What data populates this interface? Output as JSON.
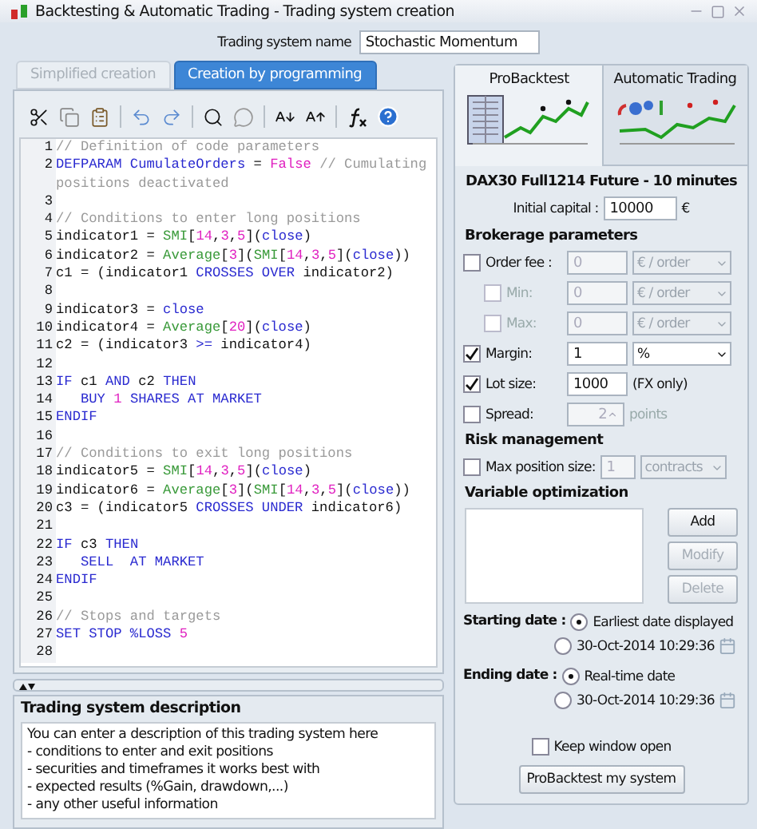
{
  "window": {
    "title": "Backtesting & Automatic Trading - Trading system creation"
  },
  "name_field": {
    "label": "Trading system name",
    "value": "Stochastic Momentum"
  },
  "editor_tabs": [
    {
      "label": "Simplified creation",
      "selected": false
    },
    {
      "label": "Creation by programming",
      "selected": true
    }
  ],
  "code_lines": [
    {
      "number": "1",
      "tokens": [
        {
          "kind": "comment",
          "text": "// Definition of code parameters"
        }
      ]
    },
    {
      "number": "2",
      "tokens": [
        {
          "kind": "keyword",
          "text": "DEFPARAM CumulateOrders"
        },
        {
          "kind": "plain",
          "text": " = "
        },
        {
          "kind": "number",
          "text": "False"
        },
        {
          "kind": "comment",
          "text": " // Cumulating"
        }
      ]
    },
    {
      "tokens": [
        {
          "kind": "comment",
          "text": "positions deactivated"
        }
      ]
    },
    {
      "number": "3"
    },
    {
      "number": "4",
      "tokens": [
        {
          "kind": "comment",
          "text": "// Conditions to enter long positions"
        }
      ]
    },
    {
      "number": "5",
      "tokens": [
        {
          "kind": "plain",
          "text": "indicator1 = "
        },
        {
          "kind": "function",
          "text": "SMI"
        },
        {
          "kind": "plain",
          "text": "["
        },
        {
          "kind": "number",
          "text": "14"
        },
        {
          "kind": "plain",
          "text": ","
        },
        {
          "kind": "number",
          "text": "3"
        },
        {
          "kind": "plain",
          "text": ","
        },
        {
          "kind": "number",
          "text": "5"
        },
        {
          "kind": "plain",
          "text": "]("
        },
        {
          "kind": "keyword",
          "text": "close"
        },
        {
          "kind": "plain",
          "text": ")"
        }
      ]
    },
    {
      "number": "6",
      "tokens": [
        {
          "kind": "plain",
          "text": "indicator2 = "
        },
        {
          "kind": "function",
          "text": "Average"
        },
        {
          "kind": "plain",
          "text": "["
        },
        {
          "kind": "number",
          "text": "3"
        },
        {
          "kind": "plain",
          "text": "]("
        },
        {
          "kind": "function",
          "text": "SMI"
        },
        {
          "kind": "plain",
          "text": "["
        },
        {
          "kind": "number",
          "text": "14"
        },
        {
          "kind": "plain",
          "text": ","
        },
        {
          "kind": "number",
          "text": "3"
        },
        {
          "kind": "plain",
          "text": ","
        },
        {
          "kind": "number",
          "text": "5"
        },
        {
          "kind": "plain",
          "text": "]("
        },
        {
          "kind": "keyword",
          "text": "close"
        },
        {
          "kind": "plain",
          "text": "))"
        }
      ]
    },
    {
      "number": "7",
      "tokens": [
        {
          "kind": "plain",
          "text": "c1 = (indicator1 "
        },
        {
          "kind": "keyword",
          "text": "CROSSES OVER"
        },
        {
          "kind": "plain",
          "text": " indicator2)"
        }
      ]
    },
    {
      "number": "8"
    },
    {
      "number": "9",
      "tokens": [
        {
          "kind": "plain",
          "text": "indicator3 = "
        },
        {
          "kind": "keyword",
          "text": "close"
        }
      ]
    },
    {
      "number": "10",
      "tokens": [
        {
          "kind": "plain",
          "text": "indicator4 = "
        },
        {
          "kind": "function",
          "text": "Average"
        },
        {
          "kind": "plain",
          "text": "["
        },
        {
          "kind": "number",
          "text": "20"
        },
        {
          "kind": "plain",
          "text": "]("
        },
        {
          "kind": "keyword",
          "text": "close"
        },
        {
          "kind": "plain",
          "text": ")"
        }
      ]
    },
    {
      "number": "11",
      "tokens": [
        {
          "kind": "plain",
          "text": "c2 = (indicator3 "
        },
        {
          "kind": "keyword",
          "text": ">="
        },
        {
          "kind": "plain",
          "text": " indicator4)"
        }
      ]
    },
    {
      "number": "12"
    },
    {
      "number": "13",
      "tokens": [
        {
          "kind": "keyword",
          "text": "IF"
        },
        {
          "kind": "plain",
          "text": " c1 "
        },
        {
          "kind": "keyword",
          "text": "AND"
        },
        {
          "kind": "plain",
          "text": " c2 "
        },
        {
          "kind": "keyword",
          "text": "THEN"
        }
      ]
    },
    {
      "number": "14",
      "tokens": [
        {
          "kind": "keyword",
          "text": "   BUY "
        },
        {
          "kind": "number",
          "text": "1"
        },
        {
          "kind": "keyword",
          "text": " SHARES AT MARKET"
        }
      ]
    },
    {
      "number": "15",
      "tokens": [
        {
          "kind": "keyword",
          "text": "ENDIF"
        }
      ]
    },
    {
      "number": "16"
    },
    {
      "number": "17",
      "tokens": [
        {
          "kind": "comment",
          "text": "// Conditions to exit long positions"
        }
      ]
    },
    {
      "number": "18",
      "tokens": [
        {
          "kind": "plain",
          "text": "indicator5 = "
        },
        {
          "kind": "function",
          "text": "SMI"
        },
        {
          "kind": "plain",
          "text": "["
        },
        {
          "kind": "number",
          "text": "14"
        },
        {
          "kind": "plain",
          "text": ","
        },
        {
          "kind": "number",
          "text": "3"
        },
        {
          "kind": "plain",
          "text": ","
        },
        {
          "kind": "number",
          "text": "5"
        },
        {
          "kind": "plain",
          "text": "]("
        },
        {
          "kind": "keyword",
          "text": "close"
        },
        {
          "kind": "plain",
          "text": ")"
        }
      ]
    },
    {
      "number": "19",
      "tokens": [
        {
          "kind": "plain",
          "text": "indicator6 = "
        },
        {
          "kind": "function",
          "text": "Average"
        },
        {
          "kind": "plain",
          "text": "["
        },
        {
          "kind": "number",
          "text": "3"
        },
        {
          "kind": "plain",
          "text": "]("
        },
        {
          "kind": "function",
          "text": "SMI"
        },
        {
          "kind": "plain",
          "text": "["
        },
        {
          "kind": "number",
          "text": "14"
        },
        {
          "kind": "plain",
          "text": ","
        },
        {
          "kind": "number",
          "text": "3"
        },
        {
          "kind": "plain",
          "text": ","
        },
        {
          "kind": "number",
          "text": "5"
        },
        {
          "kind": "plain",
          "text": "]("
        },
        {
          "kind": "keyword",
          "text": "close"
        },
        {
          "kind": "plain",
          "text": "))"
        }
      ]
    },
    {
      "number": "20",
      "tokens": [
        {
          "kind": "plain",
          "text": "c3 = (indicator5 "
        },
        {
          "kind": "keyword",
          "text": "CROSSES UNDER"
        },
        {
          "kind": "plain",
          "text": " indicator6)"
        }
      ]
    },
    {
      "number": "21"
    },
    {
      "number": "22",
      "tokens": [
        {
          "kind": "keyword",
          "text": "IF"
        },
        {
          "kind": "plain",
          "text": " c3 "
        },
        {
          "kind": "keyword",
          "text": "THEN"
        }
      ]
    },
    {
      "number": "23",
      "tokens": [
        {
          "kind": "keyword",
          "text": "   SELL  AT MARKET"
        }
      ]
    },
    {
      "number": "24",
      "tokens": [
        {
          "kind": "keyword",
          "text": "ENDIF"
        }
      ]
    },
    {
      "number": "25"
    },
    {
      "number": "26",
      "tokens": [
        {
          "kind": "comment",
          "text": "// Stops and targets"
        }
      ]
    },
    {
      "number": "27",
      "tokens": [
        {
          "kind": "keyword",
          "text": "SET STOP %LOSS "
        },
        {
          "kind": "number",
          "text": "5"
        }
      ]
    },
    {
      "number": "28"
    }
  ],
  "description": {
    "title": "Trading system description",
    "lines": [
      "You can enter a description of this trading system here",
      "- conditions to enter and exit positions",
      "- securities and timeframes it works best with",
      "- expected results (%Gain, drawdown,...)",
      "- any other useful information"
    ]
  },
  "mode_tabs": [
    {
      "label": "ProBacktest",
      "selected": true
    },
    {
      "label": "Automatic Trading",
      "selected": false
    }
  ],
  "instrument": "DAX30  Full1214 Future - 10 minutes",
  "initial_capital": {
    "label": "Initial capital :",
    "value": "10000",
    "unit": "€"
  },
  "brokerage": {
    "title": "Brokerage parameters",
    "rows": [
      {
        "kind": "main",
        "label": "Order fee :",
        "checked": false,
        "enabled": false,
        "value": "0",
        "unit": {
          "kind": "select",
          "text": "€ / order"
        }
      },
      {
        "kind": "sub",
        "label": "Min:",
        "checked": false,
        "enabled": false,
        "value": "0",
        "unit": {
          "kind": "select",
          "text": "€ / order"
        }
      },
      {
        "kind": "sub",
        "label": "Max:",
        "checked": false,
        "enabled": false,
        "value": "0",
        "unit": {
          "kind": "select",
          "text": "€ / order"
        }
      },
      {
        "kind": "main",
        "label": "Margin:",
        "checked": true,
        "enabled": true,
        "value": "1",
        "unit": {
          "kind": "select",
          "text": "%"
        }
      },
      {
        "kind": "main",
        "label": "Lot size:",
        "checked": true,
        "enabled": true,
        "value": "1000",
        "unit": {
          "kind": "text",
          "text": "(FX only)"
        }
      },
      {
        "kind": "spinner",
        "label": "Spread:",
        "checked": false,
        "enabled": false,
        "value": "2",
        "unit": {
          "kind": "text",
          "text": "points"
        }
      }
    ]
  },
  "risk": {
    "title": "Risk management",
    "rows": [
      {
        "kind": "wide",
        "label": "Max position size:",
        "checked": false,
        "enabled": false,
        "value": "1",
        "unit": {
          "kind": "select",
          "text": "contracts"
        }
      }
    ]
  },
  "optimization": {
    "title": "Variable optimization",
    "buttons": [
      {
        "label": "Add",
        "disabled": false
      },
      {
        "label": "Modify",
        "disabled": true
      },
      {
        "label": "Delete",
        "disabled": true
      }
    ]
  },
  "dates": [
    {
      "label": "Starting date :",
      "options": [
        {
          "label": "Earliest date displayed",
          "selected": true,
          "calendar": false
        },
        {
          "label": "30-Oct-2014 10:29:36",
          "selected": false,
          "calendar": true
        }
      ]
    },
    {
      "label": "Ending date :",
      "options": [
        {
          "label": "Real-time date",
          "selected": true,
          "calendar": false
        },
        {
          "label": "30-Oct-2014 10:29:36",
          "selected": false,
          "calendar": true
        }
      ]
    }
  ],
  "keep_open": {
    "label": "Keep window open",
    "checked": false
  },
  "run_button": "ProBacktest my system"
}
